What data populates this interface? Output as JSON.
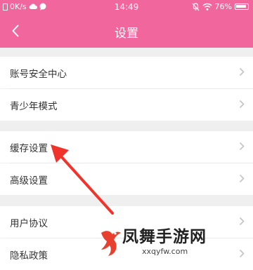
{
  "status_bar": {
    "left_text": "0K/s",
    "time": "14:49",
    "battery": "76%",
    "battery_level": 0.76,
    "icons": [
      "sim-card-icon",
      "cloud-icon",
      "chat-bubble-icon",
      "mute-icon",
      "wifi-icon",
      "battery-icon"
    ]
  },
  "header": {
    "title": "设置",
    "back_icon": "chevron-left-icon"
  },
  "settings_groups": [
    {
      "items": [
        {
          "label": "账号安全中心"
        },
        {
          "label": "青少年模式"
        }
      ]
    },
    {
      "items": [
        {
          "label": "缓存设置"
        },
        {
          "label": "高级设置"
        }
      ]
    },
    {
      "items": [
        {
          "label": "用户协议"
        },
        {
          "label": "隐私政策"
        }
      ]
    }
  ],
  "annotation": {
    "arrow_color": "#f0342c",
    "points_to": "缓存设置"
  },
  "watermark": {
    "title": "凤舞手游网",
    "url": "xxqyfw.com",
    "logo_icon": "phoenix-logo-icon"
  },
  "colors": {
    "accent": "#f1669c",
    "background": "#efefef",
    "row_bg": "#ffffff",
    "text": "#333333",
    "chevron": "#c3c3c3"
  }
}
